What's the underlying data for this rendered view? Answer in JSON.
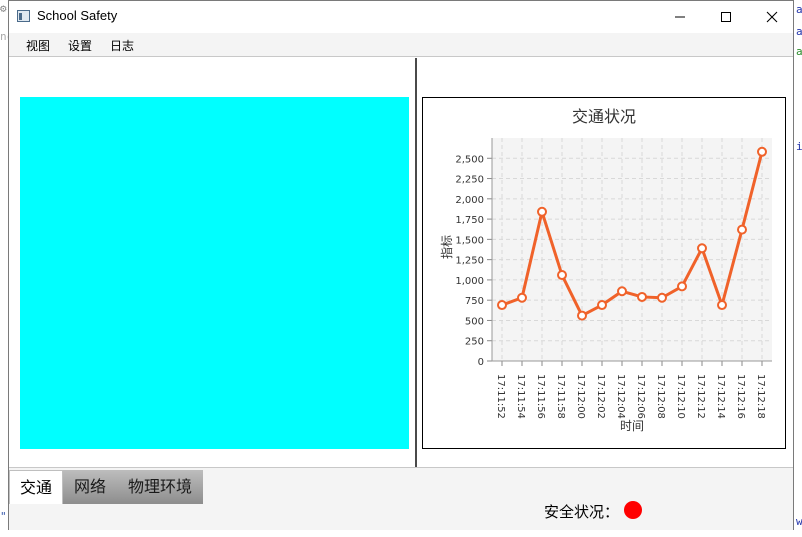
{
  "window": {
    "title": "School Safety",
    "menu": [
      "视图",
      "设置",
      "日志"
    ]
  },
  "video": {
    "fill": "#00ffff"
  },
  "chart_data": {
    "type": "line",
    "title": "交通状况",
    "xlabel": "时间",
    "ylabel": "指标",
    "categories": [
      "17:11:52",
      "17:11:54",
      "17:11:56",
      "17:11:58",
      "17:12:00",
      "17:12:02",
      "17:12:04",
      "17:12:06",
      "17:12:08",
      "17:12:10",
      "17:12:12",
      "17:12:14",
      "17:12:16",
      "17:12:18"
    ],
    "values": [
      690,
      780,
      1840,
      1060,
      560,
      690,
      860,
      790,
      780,
      920,
      1390,
      690,
      1620,
      2580
    ],
    "ylim": [
      0,
      2750
    ],
    "yticks": [
      0,
      250,
      500,
      750,
      1000,
      1250,
      1500,
      1750,
      2000,
      2250,
      2500
    ],
    "ytick_labels": [
      "0",
      "250",
      "500",
      "750",
      "1,000",
      "1,250",
      "1,500",
      "1,750",
      "2,000",
      "2,250",
      "2,500"
    ],
    "grid": true,
    "line_color": "#f0622a",
    "plot_bg": "#f4f4f4"
  },
  "tabs": [
    {
      "label": "交通",
      "active": true
    },
    {
      "label": "网络",
      "active": false
    },
    {
      "label": "物理环境",
      "active": false
    }
  ],
  "status": {
    "label": "安全状况：",
    "color": "#ff0000"
  }
}
